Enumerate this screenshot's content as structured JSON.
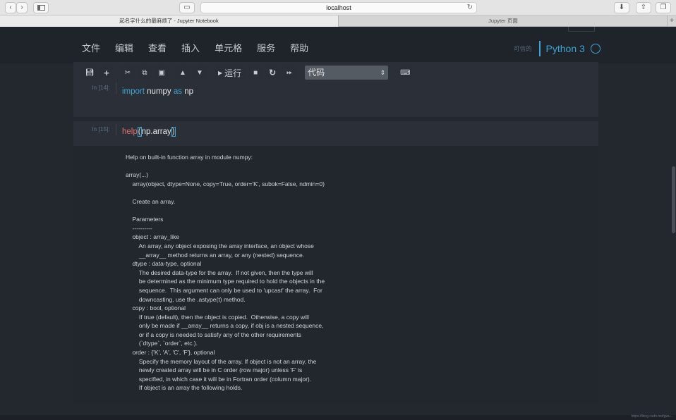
{
  "browser": {
    "url": "localhost",
    "tabs": [
      {
        "title": "起名字什么的最麻烦了 - Jupyter Notebook",
        "active": true
      },
      {
        "title": "Jupyter 页面",
        "active": false
      }
    ],
    "buttons": {
      "back": "‹",
      "forward": "›",
      "add_tab": "+"
    }
  },
  "header": {
    "menu": [
      "文件",
      "编辑",
      "查看",
      "插入",
      "单元格",
      "服务",
      "帮助"
    ],
    "trusted": "可信的",
    "kernel": "Python 3"
  },
  "toolbar": {
    "run_label": "运行",
    "cell_type": "代码"
  },
  "cells": [
    {
      "prompt": "In [14]:",
      "code_kw1": "import",
      "code_mid": " numpy ",
      "code_kw2": "as",
      "code_end": " np"
    },
    {
      "prompt": "In [15]:",
      "code_fn": "help",
      "code_arg": "np.array",
      "output": "Help on built-in function array in module numpy:\n\narray(...)\n    array(object, dtype=None, copy=True, order='K', subok=False, ndmin=0)\n\n    Create an array.\n\n    Parameters\n    ----------\n    object : array_like\n        An array, any object exposing the array interface, an object whose\n        __array__ method returns an array, or any (nested) sequence.\n    dtype : data-type, optional\n        The desired data-type for the array.  If not given, then the type will\n        be determined as the minimum type required to hold the objects in the\n        sequence.  This argument can only be used to 'upcast' the array.  For\n        downcasting, use the .astype(t) method.\n    copy : bool, optional\n        If true (default), then the object is copied.  Otherwise, a copy will\n        only be made if __array__ returns a copy, if obj is a nested sequence,\n        or if a copy is needed to satisfy any of the other requirements\n        (`dtype`, `order`, etc.).\n    order : {'K', 'A', 'C', 'F'}, optional\n        Specify the memory layout of the array. If object is not an array, the\n        newly created array will be in C order (row major) unless 'F' is\n        specified, in which case it will be in Fortran order (column major).\n        If object is an array the following holds."
    }
  ],
  "watermark": "https://blog.csdn.net/gwu...",
  "colors": {
    "accent": "#3fa3d4",
    "background": "#23272e",
    "cell": "#2b3038",
    "function": "#e0706d"
  }
}
